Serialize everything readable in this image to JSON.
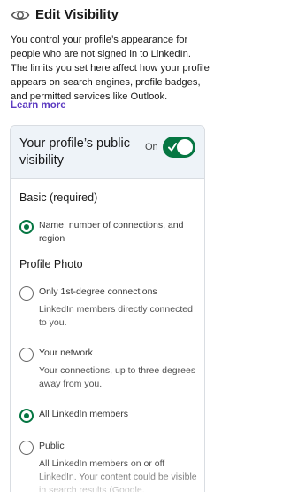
{
  "header": {
    "title": "Edit Visibility",
    "icon": "eye-icon"
  },
  "description": "You control your profile’s appearance for people who are not signed in to LinkedIn. The limits you set here affect how your profile appears on search engines, profile badges, and permitted services like Outlook.",
  "learn_more": "Learn more",
  "visibility": {
    "title": "Your profile’s public visibility",
    "toggle_label": "On",
    "enabled": true,
    "accent_color": "#057642"
  },
  "basic": {
    "heading": "Basic (required)",
    "option": {
      "label": "Name, number of connections, and region",
      "selected": true
    }
  },
  "profile_photo": {
    "heading": "Profile Photo",
    "options": [
      {
        "label": "Only 1st-degree connections",
        "sub": "LinkedIn members directly connected to you.",
        "selected": false
      },
      {
        "label": "Your network",
        "sub": "Your connections, up to three degrees away from you.",
        "selected": false
      },
      {
        "label": "All LinkedIn members",
        "sub": "",
        "selected": true
      },
      {
        "label": "Public",
        "sub": "All LinkedIn members on or off LinkedIn. Your content could be visible in search results (Google,",
        "selected": false
      }
    ]
  }
}
